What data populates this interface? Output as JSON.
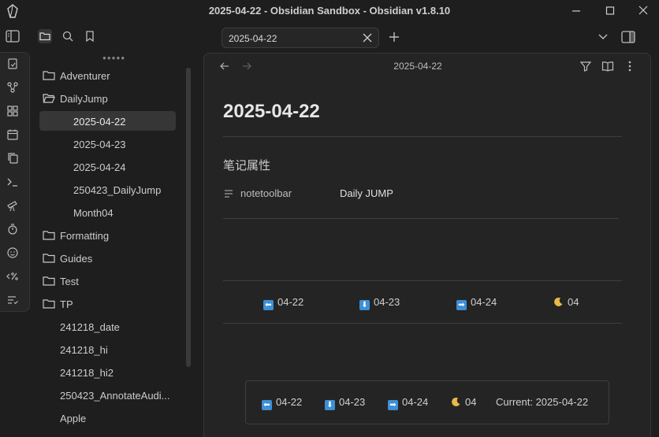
{
  "window": {
    "title": "2025-04-22 - Obsidian Sandbox - Obsidian v1.8.10"
  },
  "explorer": {
    "tree": [
      {
        "label": "Adventurer",
        "type": "folder",
        "expanded": false
      },
      {
        "label": "DailyJump",
        "type": "folder",
        "expanded": true
      },
      {
        "label": "2025-04-22",
        "type": "subfile",
        "active": true
      },
      {
        "label": "2025-04-23",
        "type": "subfile"
      },
      {
        "label": "2025-04-24",
        "type": "subfile"
      },
      {
        "label": "250423_DailyJump",
        "type": "subfile"
      },
      {
        "label": "Month04",
        "type": "subfile"
      },
      {
        "label": "Formatting",
        "type": "folder",
        "expanded": false
      },
      {
        "label": "Guides",
        "type": "folder",
        "expanded": false
      },
      {
        "label": "Test",
        "type": "folder",
        "expanded": false
      },
      {
        "label": "TP",
        "type": "folder",
        "expanded": false
      },
      {
        "label": "241218_date",
        "type": "file"
      },
      {
        "label": "241218_hi",
        "type": "file"
      },
      {
        "label": "241218_hi2",
        "type": "file"
      },
      {
        "label": "250423_AnnotateAudi...",
        "type": "file"
      },
      {
        "label": "Apple",
        "type": "file"
      }
    ]
  },
  "tabs": [
    {
      "label": "2025-04-22"
    }
  ],
  "view": {
    "header_title": "2025-04-22"
  },
  "note": {
    "title": "2025-04-22",
    "properties_heading": "笔记属性",
    "properties": [
      {
        "key": "notetoolbar",
        "value": "Daily JUMP"
      }
    ],
    "jump_row": [
      {
        "icon": "left-arrow-icon",
        "label": "04-22"
      },
      {
        "icon": "down-arrow-icon",
        "label": "04-23"
      },
      {
        "icon": "right-arrow-icon",
        "label": "04-24"
      },
      {
        "icon": "crescent-moon-icon",
        "label": "04"
      }
    ],
    "toolbar": {
      "items": [
        {
          "icon": "left-arrow-icon",
          "label": "04-22"
        },
        {
          "icon": "down-arrow-icon",
          "label": "04-23"
        },
        {
          "icon": "right-arrow-icon",
          "label": "04-24"
        },
        {
          "icon": "crescent-moon-icon",
          "label": "04"
        }
      ],
      "current_text": "Current: 2025-04-22"
    }
  },
  "colors": {
    "background": "#1e1e1e",
    "pane": "#242424",
    "accent_blue": "#3d8fd6",
    "moon": "#e8b84a"
  }
}
